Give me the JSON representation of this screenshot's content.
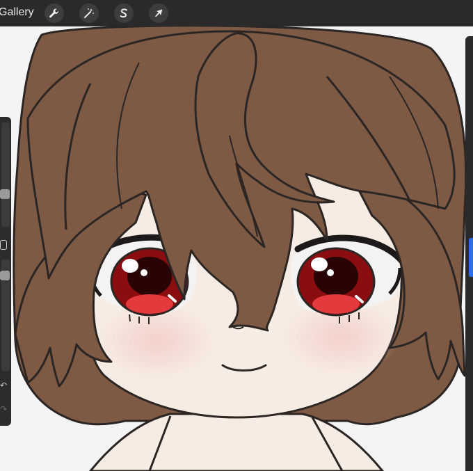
{
  "topbar": {
    "gallery_label": "Gallery",
    "tools": [
      {
        "name": "wrench-icon",
        "role": "actions"
      },
      {
        "name": "magic-wand-icon",
        "role": "adjustments"
      },
      {
        "name": "selection-s-icon",
        "role": "selection"
      },
      {
        "name": "arrow-cursor-icon",
        "role": "transform"
      }
    ]
  },
  "colors": {
    "toolbar_bg": "#2a2a2a",
    "hair": "#7e5a44",
    "skin": "#f6ece4",
    "outline": "#2b2523",
    "iris": "#8a0d10",
    "iris_highlight": "#e23a3d",
    "accent": "#2d6df6"
  }
}
